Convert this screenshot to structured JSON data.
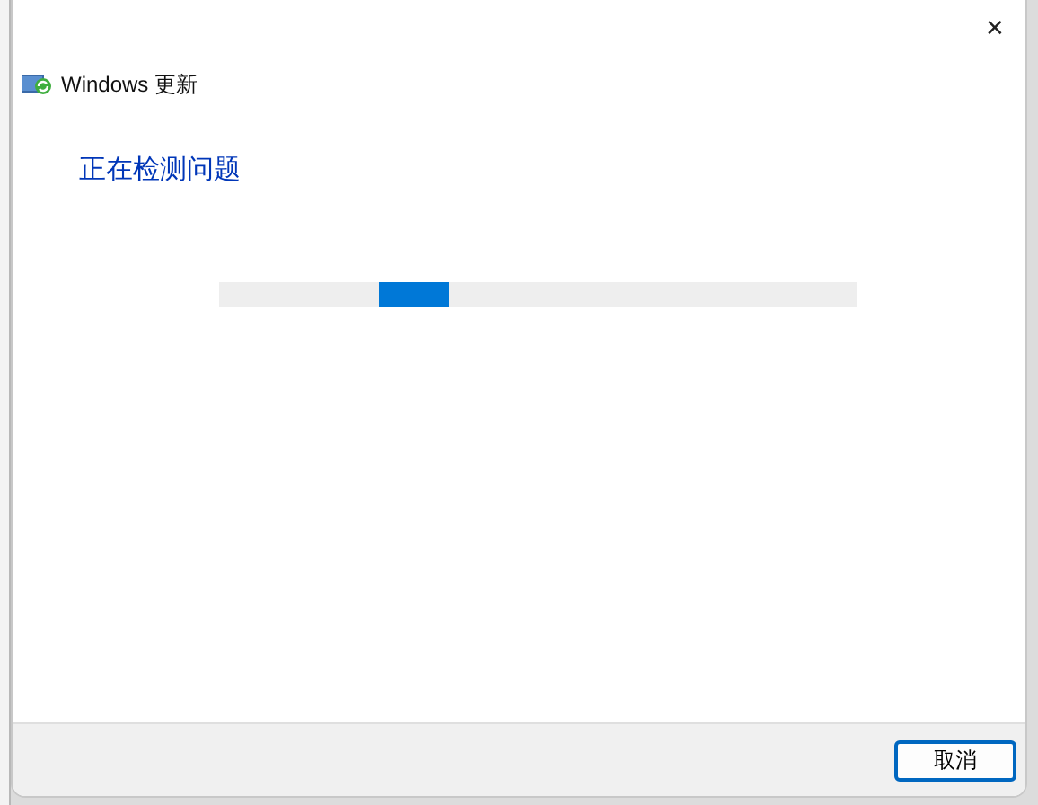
{
  "window": {
    "title": "Windows 更新",
    "close": "✕"
  },
  "heading": "正在检测问题",
  "buttons": [
    {
      "label": "取消",
      "focused": true
    }
  ]
}
